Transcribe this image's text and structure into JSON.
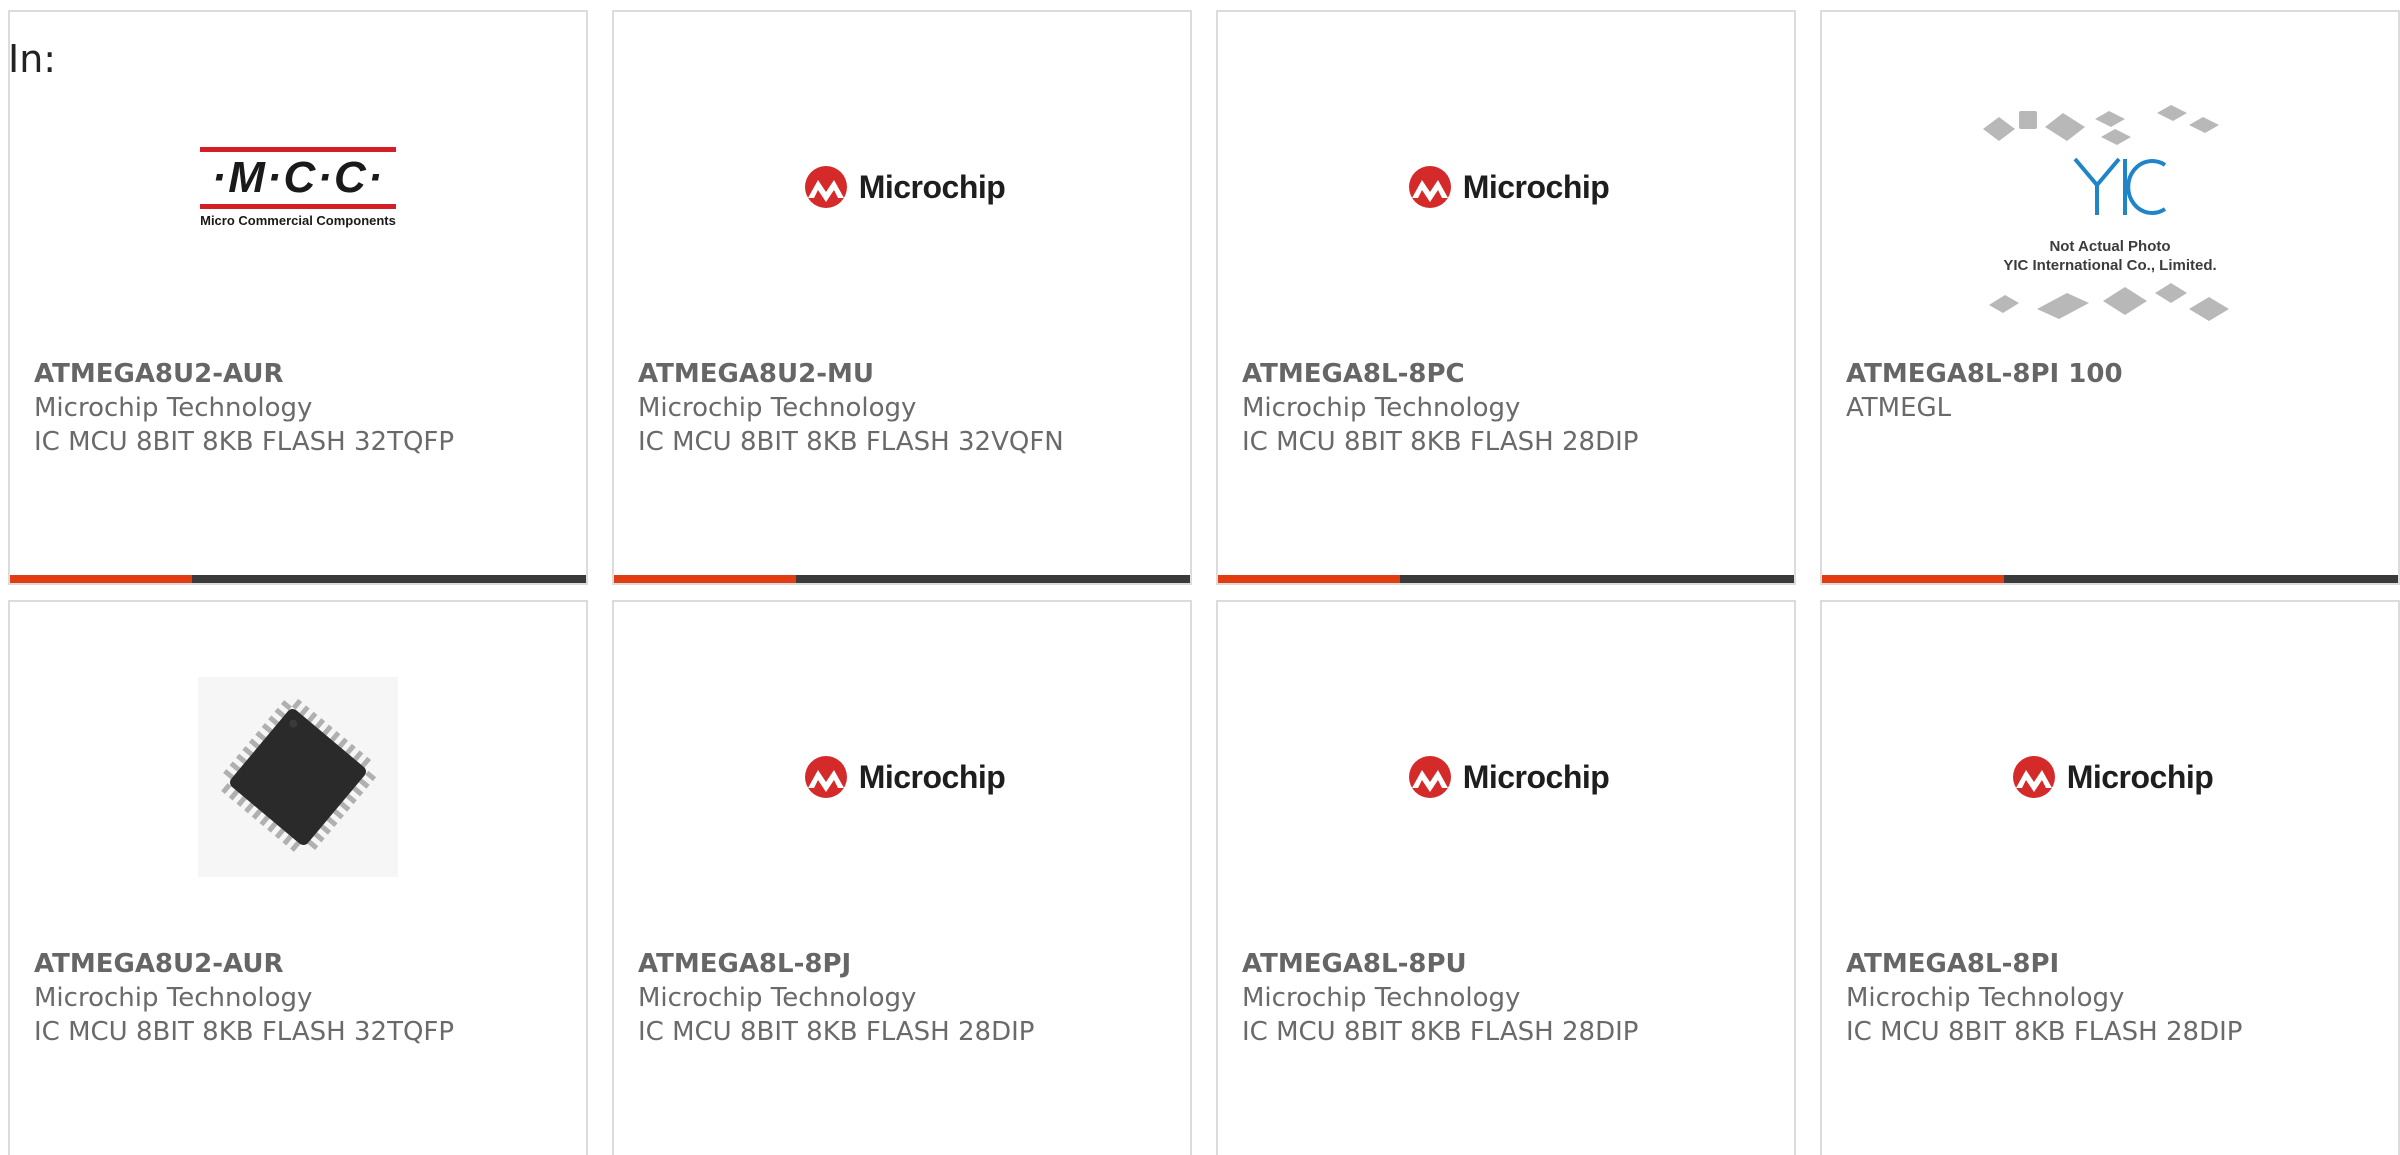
{
  "header": {
    "prefix": "In:"
  },
  "logos": {
    "mcc": {
      "text": "·M·C·C·",
      "subtitle": "Micro Commercial Components"
    },
    "microchip": {
      "text": "Microchip"
    },
    "yic": {
      "mark": "YIC",
      "line1": "Not Actual Photo",
      "line2": "YIC International Co., Limited."
    }
  },
  "colors": {
    "accent": "#e23c12",
    "bar": "#3a3a3a",
    "border": "#dcdcdc",
    "microchip_red": "#d42a2a"
  },
  "cards": [
    {
      "part_number": "ATMEGA8U2-AUR",
      "manufacturer": "Microchip Technology",
      "description": "IC MCU 8BIT 8KB FLASH 32TQFP",
      "image": "mcc-logo"
    },
    {
      "part_number": "ATMEGA8U2-MU",
      "manufacturer": "Microchip Technology",
      "description": "IC MCU 8BIT 8KB FLASH 32VQFN",
      "image": "microchip-logo"
    },
    {
      "part_number": "ATMEGA8L-8PC",
      "manufacturer": "Microchip Technology",
      "description": "IC MCU 8BIT 8KB FLASH 28DIP",
      "image": "microchip-logo"
    },
    {
      "part_number": "ATMEGA8L-8PI 100",
      "manufacturer": "ATMEGL",
      "description": "",
      "image": "yic-not-actual-photo"
    },
    {
      "part_number": "ATMEGA8U2-AUR",
      "manufacturer": "Microchip Technology",
      "description": "IC MCU 8BIT 8KB FLASH 32TQFP",
      "image": "tqfp-chip-photo"
    },
    {
      "part_number": "ATMEGA8L-8PJ",
      "manufacturer": "Microchip Technology",
      "description": "IC MCU 8BIT 8KB FLASH 28DIP",
      "image": "microchip-logo"
    },
    {
      "part_number": "ATMEGA8L-8PU",
      "manufacturer": "Microchip Technology",
      "description": "IC MCU 8BIT 8KB FLASH 28DIP",
      "image": "microchip-logo"
    },
    {
      "part_number": "ATMEGA8L-8PI",
      "manufacturer": "Microchip Technology",
      "description": "IC MCU 8BIT 8KB FLASH 28DIP",
      "image": "microchip-logo"
    }
  ]
}
